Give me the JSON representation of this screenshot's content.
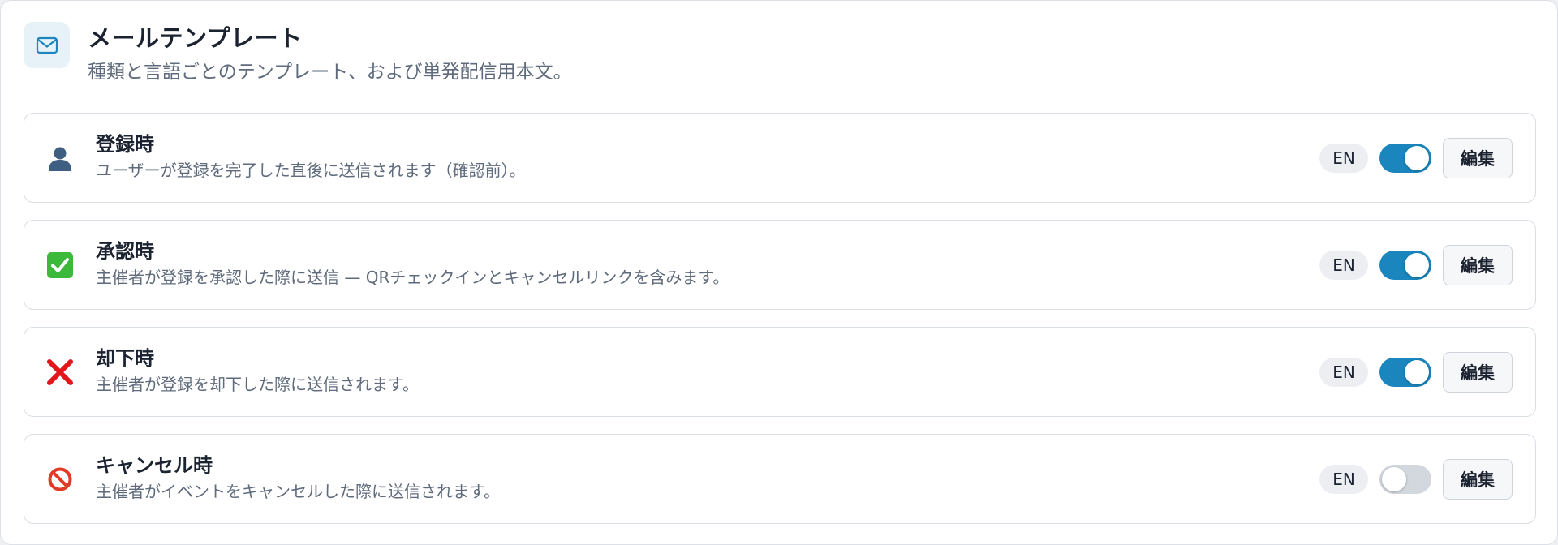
{
  "header": {
    "icon": "mail-icon",
    "title": "メールテンプレート",
    "subtitle": "種類と言語ごとのテンプレート、および単発配信用本文。"
  },
  "colors": {
    "accent": "#1a86bd",
    "toggle_off": "#d3d7de"
  },
  "templates": [
    {
      "icon": "user-silhouette-icon",
      "title": "登録時",
      "description": "ユーザーが登録を完了した直後に送信されます（確認前）。",
      "lang": "EN",
      "enabled": true,
      "edit_label": "編集"
    },
    {
      "icon": "check-mark-button-icon",
      "title": "承認時",
      "description": "主催者が登録を承認した際に送信 — QRチェックインとキャンセルリンクを含みます。",
      "lang": "EN",
      "enabled": true,
      "edit_label": "編集"
    },
    {
      "icon": "cross-mark-icon",
      "title": "却下時",
      "description": "主催者が登録を却下した際に送信されます。",
      "lang": "EN",
      "enabled": true,
      "edit_label": "編集"
    },
    {
      "icon": "prohibited-icon",
      "title": "キャンセル時",
      "description": "主催者がイベントをキャンセルした際に送信されます。",
      "lang": "EN",
      "enabled": false,
      "edit_label": "編集"
    }
  ]
}
